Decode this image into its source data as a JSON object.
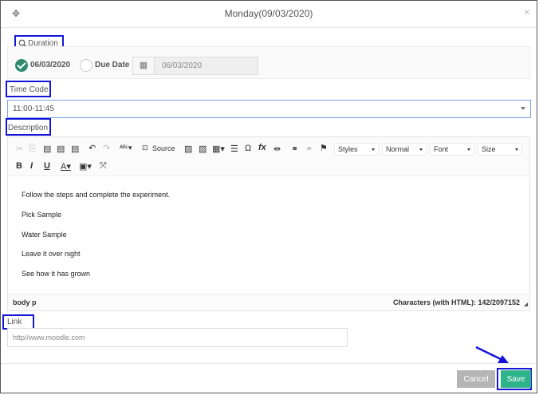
{
  "dialog": {
    "title": "Monday(09/03/2020)",
    "move_icon": "move-icon",
    "close_icon": "close-icon"
  },
  "duration": {
    "label": "Duration",
    "selected_option": "06/03/2020",
    "other_option": "Due Date",
    "date_value": "06/03/2020"
  },
  "time_code": {
    "label": "Time Code",
    "value": "11:00-11:45"
  },
  "description": {
    "label": "Description",
    "toolbar": {
      "source": "Source",
      "styles": "Styles",
      "format": "Normal",
      "font": "Font",
      "size": "Size",
      "bold": "B",
      "italic": "I",
      "underline": "U"
    },
    "content": [
      "Follow the steps and complete the experiment.",
      "Pick Sample",
      "Water Sample",
      "Leave it over night",
      "See how it has grown"
    ],
    "status_path": "body  p",
    "char_count": "Characters (with HTML): 142/2097152"
  },
  "link": {
    "label": "Link",
    "placeholder": "http//www.moodle.com"
  },
  "buttons": {
    "cancel": "Cancel",
    "save": "Save"
  },
  "colors": {
    "highlight": "#1515d9",
    "save": "#2eb38a",
    "cancel": "#b5b5b5",
    "check": "#2e8b6e"
  }
}
